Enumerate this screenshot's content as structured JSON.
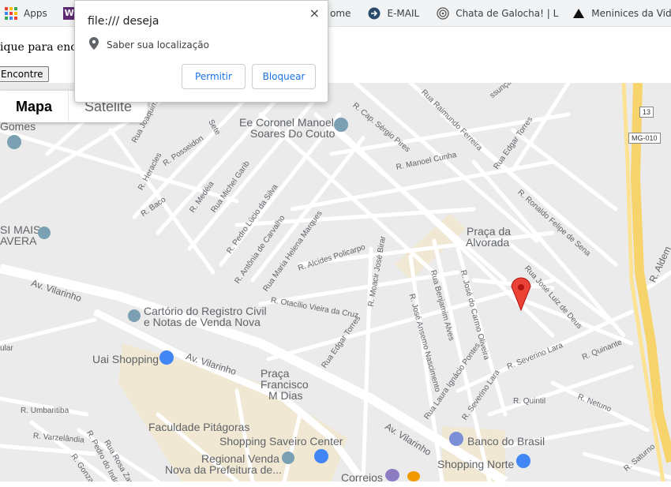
{
  "bookmarks": [
    {
      "label": "Apps",
      "icon": "apps-grid-icon"
    },
    {
      "label": "M",
      "icon": "w-logo-icon"
    },
    {
      "label": "ome",
      "icon": ""
    },
    {
      "label": "E-MAIL",
      "icon": "circle-arrow-icon"
    },
    {
      "label": "Chata de Galocha! | L",
      "icon": "swirl-icon"
    },
    {
      "label": "Meninices da Vida",
      "icon": "triangle-icon"
    },
    {
      "label": "",
      "icon": "facebook-icon"
    }
  ],
  "page": {
    "text": "ique para enco",
    "button_label": "Encontre"
  },
  "popup": {
    "title": "file:/// deseja",
    "close": "×",
    "message": "Saber sua localização",
    "allow": "Permitir",
    "block": "Bloquear"
  },
  "map": {
    "map_type": {
      "map": "Mapa",
      "satellite": "Satélite"
    },
    "route_shields": [
      "13",
      "MG-010"
    ],
    "poi": {
      "gomes": "Gomes",
      "si_mais": "SI MAIS",
      "avera": "AVERA",
      "coronel_1": "Ee Coronel Manoel",
      "coronel_2": "Soares Do Couto",
      "praca_alvorada_1": "Praça da",
      "praca_alvorada_2": "Alvorada",
      "cartorio_1": "Cartório do Registro Civil",
      "cartorio_2": "e Notas de Venda Nova",
      "uai": "Uai Shopping",
      "praca_fd_1": "Praça",
      "praca_fd_2": "Francisco",
      "praca_fd_3": "M Dias",
      "pitagoras": "Faculdade Pitágoras",
      "saveiro": "Shopping Saveiro Center",
      "regional_1": "Regional Venda",
      "regional_2": "Nova da Prefeitura de...",
      "banco": "Banco do Brasil",
      "norte": "Shopping Norte",
      "correios": "Correios"
    },
    "streets": {
      "vilarinho_1": "Av. Vilarinho",
      "vilarinho_2": "Av. Vilarinho",
      "vilarinho_3": "Av. Vilarinho",
      "heracles": "R. Heracles",
      "posseidon": "R. Posseidon",
      "joaquim": "Rua Joaquim Meire",
      "sete": "Sete",
      "baco": "R. Baco",
      "medeia": "R. Medéia",
      "michel": "Rua Michel Garib",
      "pedro": "R. Pedro Lúcio da Silva",
      "antonia": "R. Antônia de Carvalho",
      "helena": "Rua Maria Helena Marques",
      "alcides": "R. Alcides Policarpo",
      "otacilio": "R. Otacílio Vieira da Cruz",
      "moacir": "R. Moacir José Birar",
      "edgar_1": "Rua Edgar Torres",
      "edgar_2": "Rua Edgar Torres",
      "benjamim": "Rua Benjamim Alves",
      "ansemo": "R. José Ansemo Nascimento",
      "carmo": "R. José do Carmo Oliveira",
      "laura": "Rua Laura Ignácio Pontes",
      "severino_1": "R. Severino Lara",
      "severino_2": "R. Severino Lara",
      "quintil": "R. Quintil",
      "netuno": "R. Netuno",
      "quinante": "R. Quinante",
      "saturno": "R. Saturno",
      "aldem": "R. Aldem",
      "luiz": "Rua José Luiz de Deus",
      "ronaldo": "R. Ronaldo Felipe de Sena",
      "cunha": "R. Manoel Cunha",
      "sergio": "R. Cap. Sérgio Pires",
      "raimundo": "Rua Raimundo Ferreira",
      "assuncao": "ssunção",
      "umbaritiba": "R. Umbaritiba",
      "varzelandia": "R. Varzelândia",
      "indaia": "R. Pedro do Indaiá",
      "zandona": "Rua Rosa Zandona",
      "gonzaga": "R. Gonzaga",
      "ular": "ular"
    }
  },
  "colors": {
    "map_bg": "#ebebeb",
    "road": "#ffffff",
    "highway": "#f6d36b",
    "commercial": "#f1e8d3",
    "pin": "#ea4335",
    "link": "#1a73e8"
  }
}
